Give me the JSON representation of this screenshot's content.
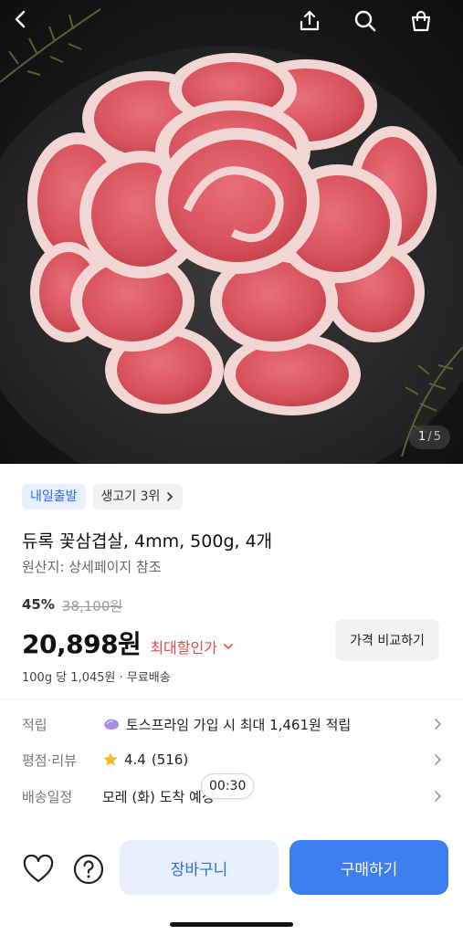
{
  "hero": {
    "counter_current": "1",
    "counter_sep": "/",
    "counter_total": "5"
  },
  "nav": {
    "back_icon": "chevron-left-icon",
    "share_icon": "share-icon",
    "search_icon": "search-icon",
    "cart_icon": "bag-icon"
  },
  "badges": {
    "delivery": "내일출발",
    "ranking": "생고기 3위"
  },
  "product": {
    "title": "듀록 꽃삼겹살, 4mm, 500g, 4개",
    "origin": "원산지: 상세페이지 참조",
    "discount": "45%",
    "original_price": "38,100원",
    "price": "20,898원",
    "max_discount_label": "최대할인가",
    "compare_label": "가격 비교하기",
    "unit_price": "100g 당 1,045원 · 무료배송"
  },
  "info": {
    "points_label": "적립",
    "points_value": "토스프라임 가입 시 최대 1,461원 적립",
    "rating_label": "평점·리뷰",
    "rating_value": "4.4",
    "review_count": "(516)",
    "delivery_label": "배송일정",
    "delivery_value": "모레 (화) 도착 예정",
    "timer": "00:30"
  },
  "bottom": {
    "cart_label": "장바구니",
    "buy_label": "구매하기",
    "wishlist_icon": "heart-icon",
    "help_icon": "question-icon"
  },
  "colors": {
    "accent_blue": "#3d7ef0",
    "light_blue": "#e8f0ff",
    "discount_red": "#e24a4a"
  }
}
